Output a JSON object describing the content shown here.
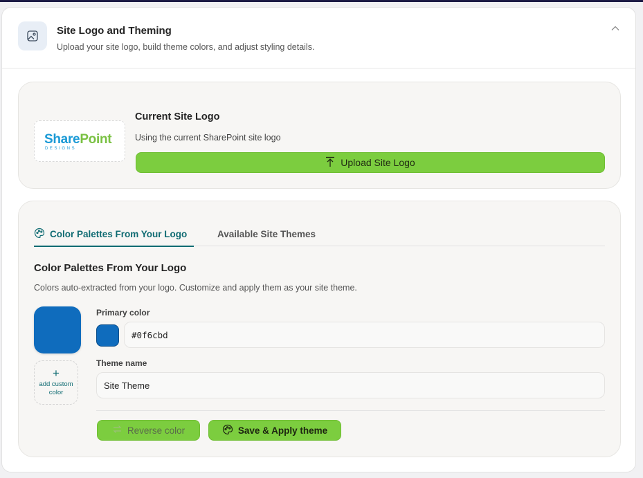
{
  "header": {
    "title": "Site Logo and Theming",
    "subtitle": "Upload your site logo, build theme colors, and adjust styling details.",
    "icon": "image-icon",
    "collapse_icon": "chevron-up-icon"
  },
  "logo_section": {
    "logo_text_part1": "Share",
    "logo_text_part2": "Point",
    "logo_text_sub": "DESIGNS",
    "title": "Current Site Logo",
    "subtitle": "Using the current SharePoint site logo",
    "upload_label": "Upload Site Logo",
    "upload_icon": "upload-icon"
  },
  "palette_section": {
    "tabs": [
      {
        "label": "Color Palettes From Your Logo",
        "icon": "palette-icon",
        "active": true
      },
      {
        "label": "Available Site Themes",
        "active": false
      }
    ],
    "title": "Color Palettes From Your Logo",
    "subtitle": "Colors auto-extracted from your logo. Customize and apply them as your site theme.",
    "swatch_color": "#0f6cbd",
    "add_custom_label": "add custom color",
    "primary_color_label": "Primary color",
    "primary_color_value": "#0f6cbd",
    "theme_name_label": "Theme name",
    "theme_name_value": "Site Theme",
    "reverse_label": "Reverse color",
    "save_label": "Save & Apply theme"
  },
  "colors": {
    "accent_green": "#7ccd3f",
    "accent_teal": "#0f6b72",
    "primary_blue": "#0f6cbd"
  }
}
